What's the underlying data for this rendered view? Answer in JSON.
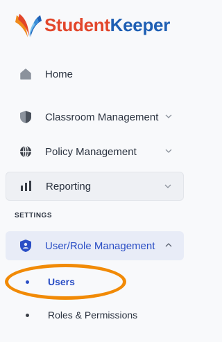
{
  "app": {
    "brand_part1": "Student",
    "brand_part2": "Keeper",
    "brand_colors": {
      "student": "#e2462b",
      "keeper": "#1e5fb4"
    }
  },
  "nav": {
    "items": [
      {
        "label": "Home",
        "icon": "home-icon",
        "expandable": false
      },
      {
        "label": "Classroom Management",
        "icon": "shield-icon",
        "expandable": true
      },
      {
        "label": "Policy Management",
        "icon": "globe-icon",
        "expandable": true
      },
      {
        "label": "Reporting",
        "icon": "bar-chart-icon",
        "expandable": true,
        "hovered": true
      }
    ]
  },
  "settings": {
    "section_title": "SETTINGS",
    "role_management": {
      "label": "User/Role Management",
      "icon": "user-shield-icon",
      "expanded": true,
      "active": true,
      "children": [
        {
          "label": "Users",
          "active": true
        },
        {
          "label": "Roles & Permissions",
          "active": false
        }
      ]
    }
  },
  "colors": {
    "accent": "#2a4ec5",
    "highlight_ring": "#f18a06",
    "sidebar_bg": "#f8f9fb",
    "active_bg": "#e8ecf7"
  }
}
